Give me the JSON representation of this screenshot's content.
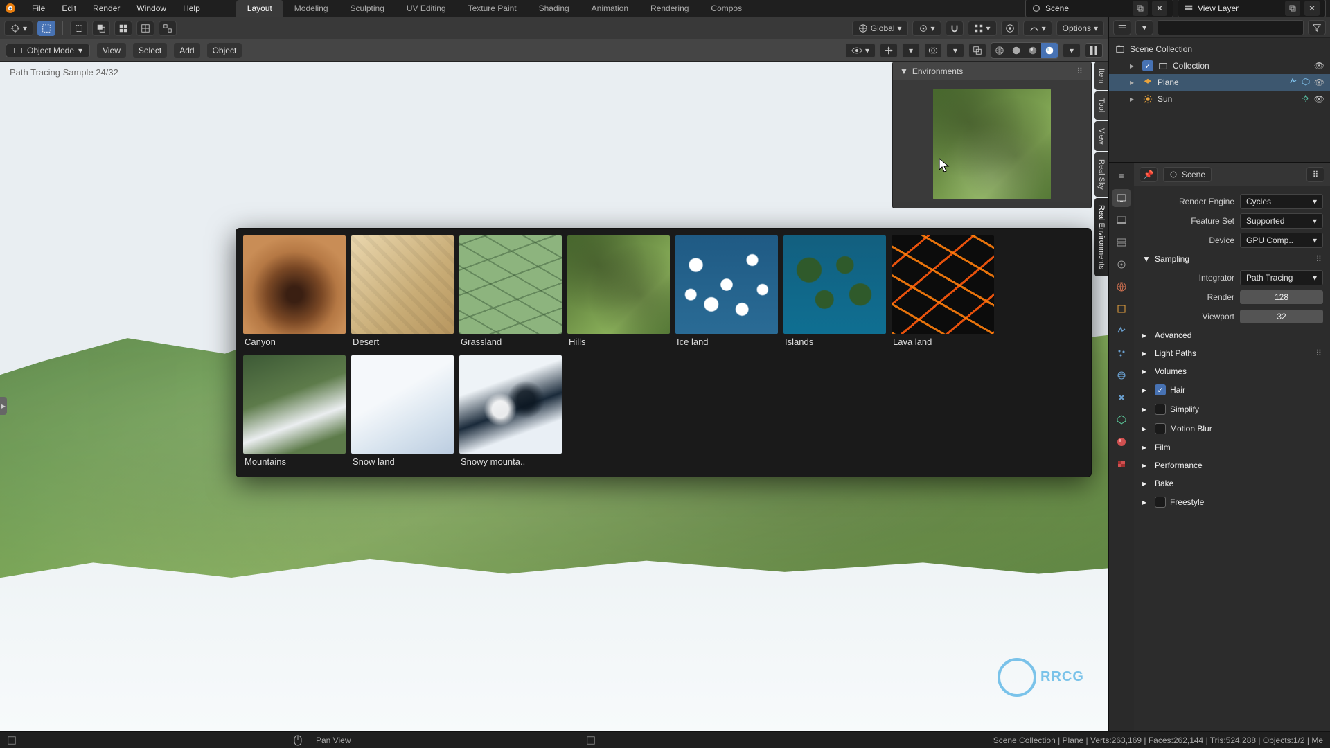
{
  "app_menu": [
    "File",
    "Edit",
    "Render",
    "Window",
    "Help"
  ],
  "workspaces": [
    "Layout",
    "Modeling",
    "Sculpting",
    "UV Editing",
    "Texture Paint",
    "Shading",
    "Animation",
    "Rendering",
    "Compos"
  ],
  "active_workspace": "Layout",
  "scene_name": "Scene",
  "view_layer": "View Layer",
  "transform_orientation": "Global",
  "options_label": "Options",
  "object_mode": "Object Mode",
  "header_menus": [
    "View",
    "Select",
    "Add",
    "Object"
  ],
  "viewport_status": "Path Tracing Sample 24/32",
  "n_panel_tabs": [
    "Item",
    "Tool",
    "View",
    "Real Sky",
    "Real Environments"
  ],
  "environments_panel_title": "Environments",
  "environments": [
    {
      "key": "canyon",
      "label": "Canyon",
      "thumb": "thumb-canyon"
    },
    {
      "key": "desert",
      "label": "Desert",
      "thumb": "thumb-desert"
    },
    {
      "key": "grassland",
      "label": "Grassland",
      "thumb": "thumb-grassland"
    },
    {
      "key": "hills",
      "label": "Hills",
      "thumb": "thumb-hills"
    },
    {
      "key": "iceland",
      "label": "Ice land",
      "thumb": "thumb-iceland"
    },
    {
      "key": "islands",
      "label": "Islands",
      "thumb": "thumb-islands"
    },
    {
      "key": "lava",
      "label": "Lava land",
      "thumb": "thumb-lava"
    },
    {
      "key": "mountains",
      "label": "Mountains",
      "thumb": "thumb-mountains"
    },
    {
      "key": "snowland",
      "label": "Snow land",
      "thumb": "thumb-snowland"
    },
    {
      "key": "snowymtn",
      "label": "Snowy mounta..",
      "thumb": "thumb-snowymtn"
    }
  ],
  "outliner": {
    "scene_collection": "Scene Collection",
    "collection": "Collection",
    "objects": [
      "Plane",
      "Sun"
    ],
    "selected": "Plane"
  },
  "properties": {
    "context": "Scene",
    "render_engine_label": "Render Engine",
    "render_engine": "Cycles",
    "feature_set_label": "Feature Set",
    "feature_set": "Supported",
    "device_label": "Device",
    "device": "GPU Comp..",
    "sampling_label": "Sampling",
    "integrator_label": "Integrator",
    "integrator": "Path Tracing",
    "render_label": "Render",
    "render_samples": "128",
    "viewport_label": "Viewport",
    "viewport_samples": "32",
    "panels": [
      "Advanced",
      "Light Paths",
      "Volumes",
      "Hair",
      "Simplify",
      "Motion Blur",
      "Film",
      "Performance",
      "Bake",
      "Freestyle"
    ],
    "hair_checked": true
  },
  "statusbar": {
    "hint": "Pan View",
    "stats": "Scene Collection | Plane | Verts:263,169 | Faces:262,144 | Tris:524,288 | Objects:1/2 | Me"
  },
  "watermark_text": "RRCG"
}
